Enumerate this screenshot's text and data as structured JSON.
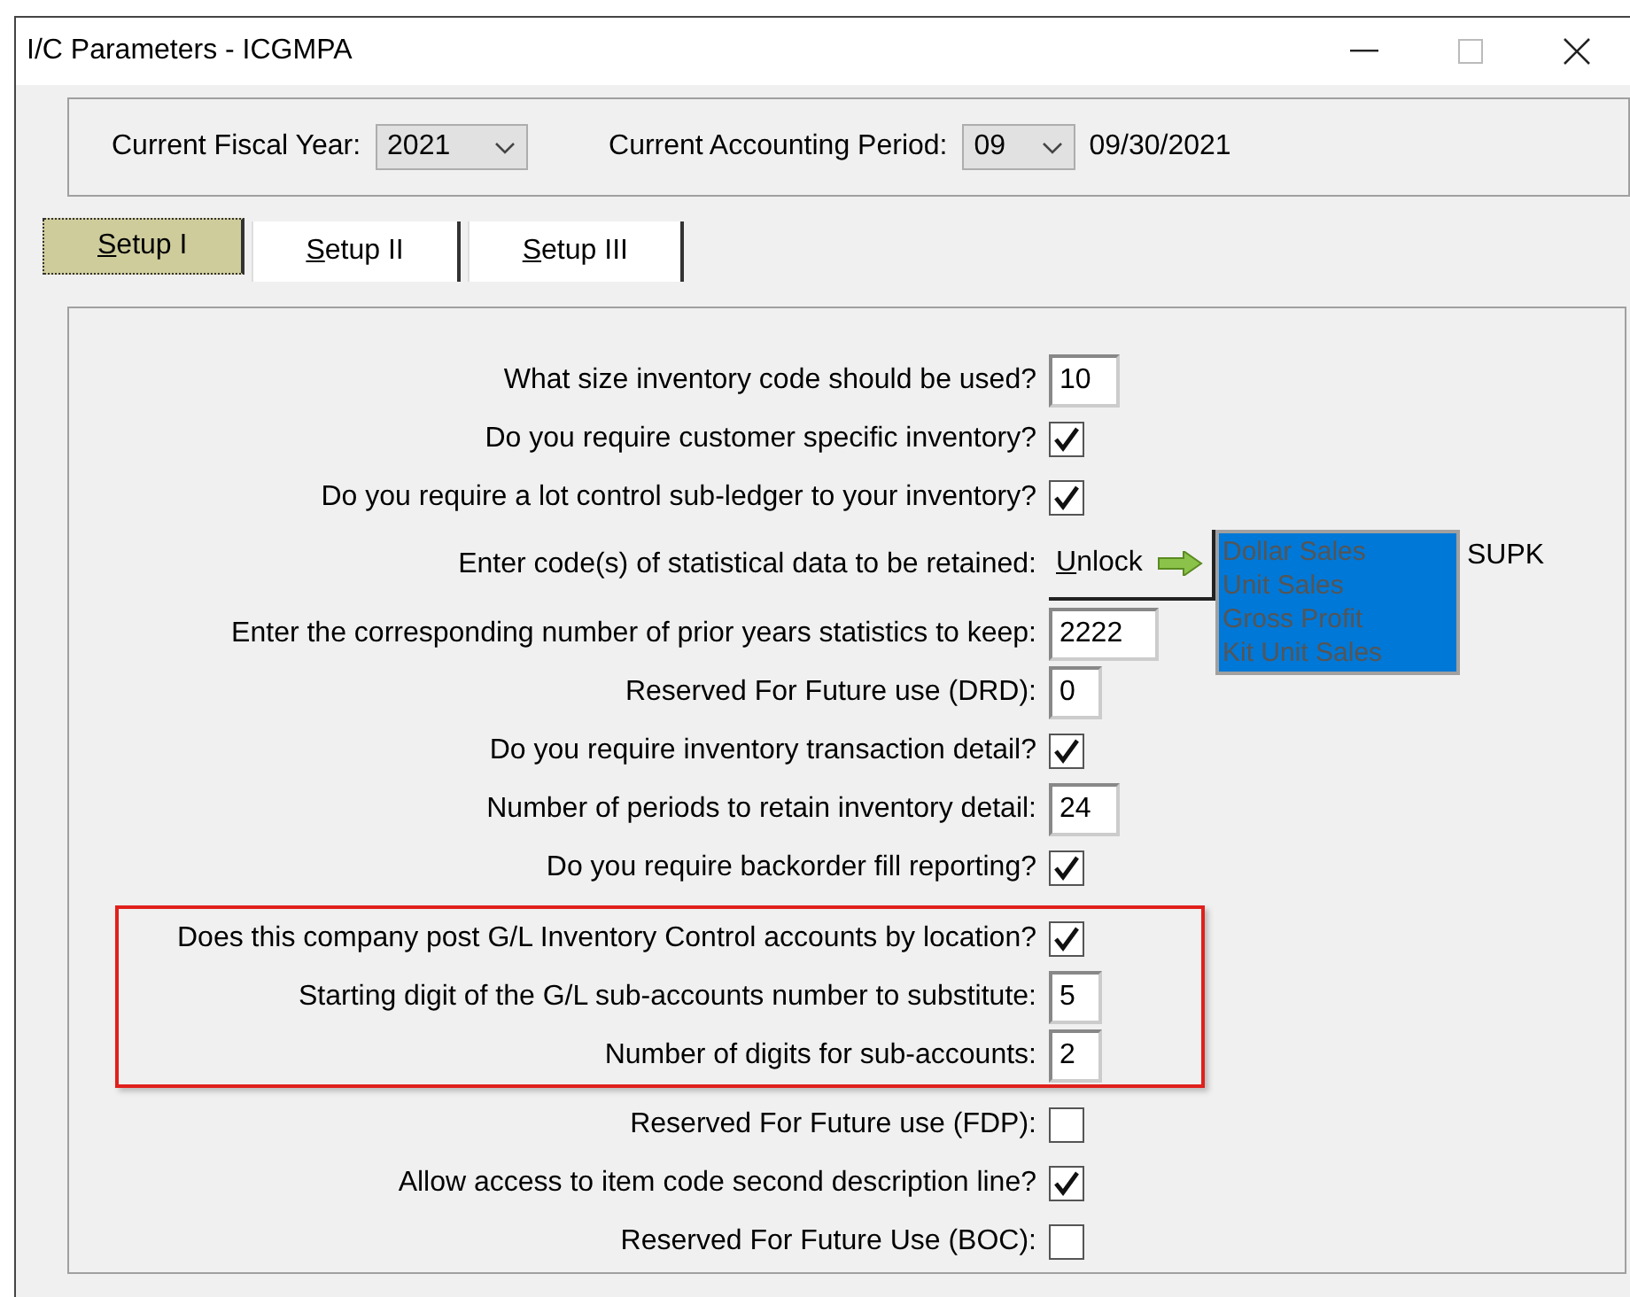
{
  "window": {
    "title": "I/C Parameters - ICGMPA"
  },
  "header": {
    "fiscal_year": {
      "label": "Current Fiscal Year:",
      "value": "2021"
    },
    "period": {
      "label": "Current Accounting Period:",
      "value": "09",
      "date": "09/30/2021"
    }
  },
  "tabs": [
    {
      "label": "Setup I",
      "selected": true
    },
    {
      "label": "Setup II",
      "selected": false
    },
    {
      "label": "Setup III",
      "selected": false
    }
  ],
  "sections": [
    {
      "highlighted": false,
      "rows": [
        {
          "kind": "text",
          "label": "What size inventory code should be used?",
          "value": "10"
        },
        {
          "kind": "check",
          "label": "Do you require customer specific inventory?",
          "checked": true
        },
        {
          "kind": "check",
          "label": "Do you require a lot control sub-ledger to your inventory?",
          "checked": true
        },
        {
          "kind": "unlock",
          "label": "Enter code(s) of statistical data to be retained:",
          "button": "Unlock",
          "list_disabled": true,
          "items": [
            {
              "text": "Dollar Sales",
              "selected": true
            },
            {
              "text": "Unit Sales",
              "selected": true
            },
            {
              "text": "Gross Profit",
              "selected": true
            },
            {
              "text": "Kit Unit Sales",
              "selected": true
            }
          ],
          "code": "SUPK"
        },
        {
          "kind": "text",
          "label": "Enter the corresponding number of prior years statistics to keep:",
          "value": "2222"
        },
        {
          "kind": "text",
          "label": "Reserved For Future use (DRD):",
          "value": "0"
        },
        {
          "kind": "check",
          "label": "Do you require inventory transaction detail?",
          "checked": true
        },
        {
          "kind": "text",
          "label": "Number of periods to retain inventory detail:",
          "value": "24"
        },
        {
          "kind": "check",
          "label": "Do you require backorder fill reporting?",
          "checked": true
        }
      ]
    },
    {
      "highlighted": true,
      "rows": [
        {
          "kind": "check",
          "label": "Does this company post G/L Inventory Control accounts by location?",
          "checked": true
        },
        {
          "kind": "text",
          "label": "Starting digit of the G/L sub-accounts number to substitute:",
          "value": "5"
        },
        {
          "kind": "text",
          "label": "Number of digits for sub-accounts:",
          "value": "2"
        }
      ]
    },
    {
      "highlighted": false,
      "rows": [
        {
          "kind": "check",
          "label": "Reserved For Future use (FDP):",
          "checked": false
        },
        {
          "kind": "check",
          "label": "Allow access to item code second description line?",
          "checked": true
        },
        {
          "kind": "check",
          "label": "Reserved For Future Use (BOC):",
          "checked": false
        }
      ]
    }
  ]
}
